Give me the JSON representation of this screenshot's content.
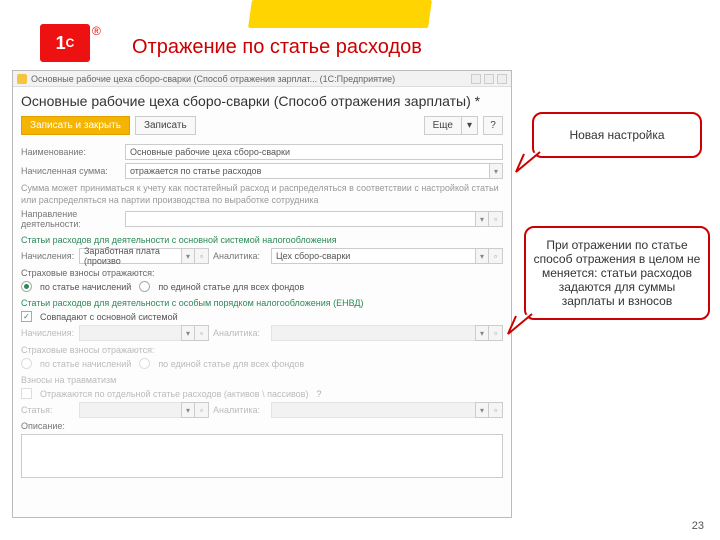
{
  "slide": {
    "title": "Отражение по статье расходов",
    "page": "23"
  },
  "win": {
    "title": "Основные рабочие цеха сборо-сварки (Способ отражения зарплат...  (1С:Предприятие)",
    "header": "Основные рабочие цеха сборо-сварки (Способ отражения зарплаты) *",
    "btn_save_close": "Записать и закрыть",
    "btn_save": "Записать",
    "btn_more": "Еще",
    "lbl_name": "Наименование:",
    "val_name": "Основные рабочие цеха сборо-сварки",
    "lbl_sum": "Начисленная сумма:",
    "val_sum": "отражается по статье расходов",
    "hint_sum": "Сумма может приниматься к учету как постатейный расход и распределяться в соответствии с настройкой статьи или распределяться на партии производства по выработке сотрудника",
    "lbl_napr": "Направление деятельности:",
    "sec_main": "Статьи расходов для деятельности с основной системой налогообложения",
    "lbl_nach": "Начисления:",
    "val_nach": "Заработная плата (произво",
    "lbl_anal": "Аналитика:",
    "val_anal": "Цех сборо-сварки",
    "sec_contrib": "Страховые взносы отражаются:",
    "radio_a": "по статье начислений",
    "radio_b": "по единой статье для всех фондов",
    "sec_envd": "Статьи расходов для деятельности с особым порядком налогообложения (ЕНВД)",
    "chk_same": "Совпадают с основной системой",
    "sec_inj": "Взносы на травматизм",
    "chk_inj": "Отражаются по отдельной статье расходов (активов \\ пассивов)",
    "lbl_item": "Статья:",
    "lbl_desc": "Описание:"
  },
  "callouts": {
    "c1": "Новая настройка",
    "c2": "При отражении по статье способ отражения в целом не меняется: статьи расходов задаются для суммы зарплаты и взносов"
  }
}
